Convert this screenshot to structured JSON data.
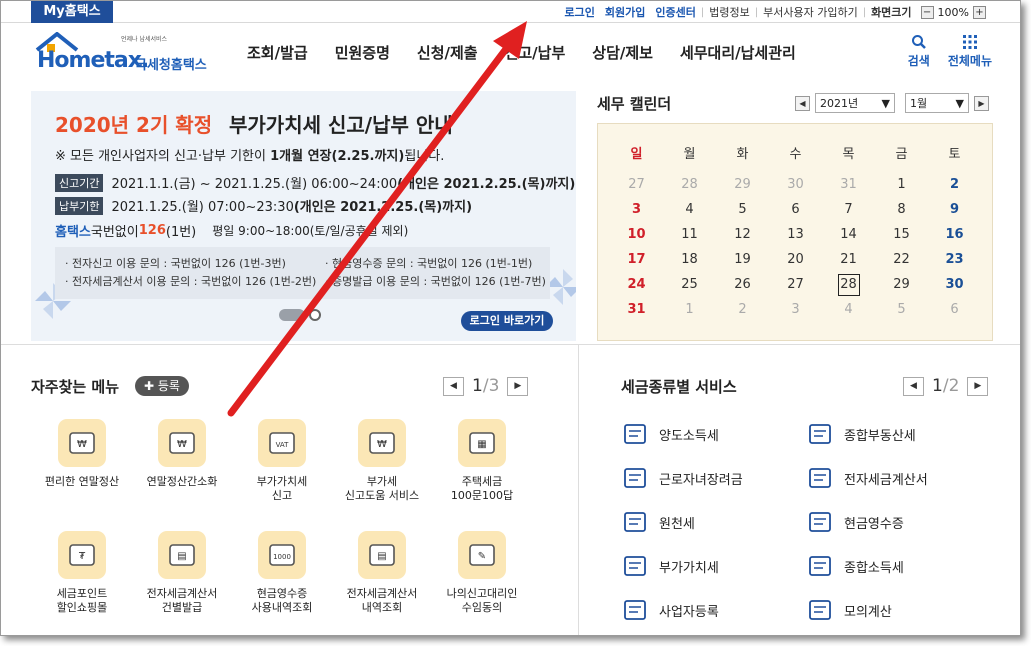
{
  "topbar": {
    "my_hometax": "My홈택스",
    "links": [
      "로그인",
      "회원가입",
      "인증센터",
      "법령정보",
      "부서사용자 가입하기",
      "화면크기"
    ],
    "zoom": "100%",
    "zoom_minus": "−",
    "zoom_plus": "+"
  },
  "logo": {
    "word": "Hometax.",
    "sub": "언제나 납세서비스",
    "kr": "국세청홈택스"
  },
  "menu": [
    "조회/발급",
    "민원증명",
    "신청/제출",
    "신고/납부",
    "상담/제보",
    "세무대리/납세관리"
  ],
  "nav_icons": {
    "search": "검색",
    "all_menu": "전체메뉴"
  },
  "banner": {
    "title_highlight": "2020년 2기 확정",
    "title_rest": "부가가치세 신고/납부 안내",
    "note_prefix": "※ 모든 개인사업자의 신고·납부 기한이 ",
    "note_bold": "1개월 연장(2.25.까지)",
    "note_suffix": "됩니다.",
    "row1_tag": "신고기간",
    "row1_text": "2021.1.1.(금) ~ 2021.1.25.(월) 06:00~24:00 ",
    "row1_bold": "(개인은 2021.2.25.(목)까지)",
    "row2_tag": "납부기한",
    "row2_text": "2021.1.25.(월) 07:00~23:30 ",
    "row2_bold": "(개인은 2021.2.25.(목)까지)",
    "row3_hometax": "홈택스",
    "row3_text": " 국번없이 ",
    "row3_num": "126",
    "row3_after": "(1번)",
    "row3_hours": "평일 9:00~18:00(토/일/공휴일 제외)",
    "info": [
      "· 전자신고 이용 문의 : 국번없이 126 (1번-3번)",
      "· 전자세금계산서 이용 문의 : 국번없이 126 (1번-2번)",
      "· 현금영수증 문의 : 국번없이 126 (1번-1번)",
      "· 증명발급 이용 문의 : 국번없이 126 (1번-7번)"
    ],
    "login_button": "로그인 바로가기"
  },
  "calendar": {
    "title": "세무 캘린더",
    "year": "2021년",
    "month": "1월",
    "weekdays": [
      "일",
      "월",
      "화",
      "수",
      "목",
      "금",
      "토"
    ],
    "weeks": [
      [
        "27",
        "28",
        "29",
        "30",
        "31",
        "1",
        "2"
      ],
      [
        "3",
        "4",
        "5",
        "6",
        "7",
        "8",
        "9"
      ],
      [
        "10",
        "11",
        "12",
        "13",
        "14",
        "15",
        "16"
      ],
      [
        "17",
        "18",
        "19",
        "20",
        "21",
        "22",
        "23"
      ],
      [
        "24",
        "25",
        "26",
        "27",
        "28",
        "29",
        "30"
      ],
      [
        "31",
        "1",
        "2",
        "3",
        "4",
        "5",
        "6"
      ]
    ],
    "today": "28"
  },
  "favorites": {
    "title": "자주찾는 메뉴",
    "register": "등록",
    "page_current": "1",
    "page_total": "3",
    "items": [
      "편리한 연말정산",
      "연말정산간소화",
      "부가가치세\n신고",
      "부가세\n신고도움 서비스",
      "주택세금\n100문100답",
      "세금포인트\n할인쇼핑몰",
      "전자세금계산서\n건별발급",
      "현금영수증\n사용내역조회",
      "전자세금계산서\n내역조회",
      "나의신고대리인\n수임동의"
    ]
  },
  "tax_services": {
    "title": "세금종류별 서비스",
    "page_current": "1",
    "page_total": "2",
    "items": [
      "양도소득세",
      "종합부동산세",
      "근로자녀장려금",
      "전자세금계산서",
      "원천세",
      "현금영수증",
      "부가가치세",
      "종합소득세",
      "사업자등록",
      "모의계산"
    ]
  },
  "colors": {
    "brand_blue": "#1f4e9a",
    "accent_orange": "#e8502b",
    "annotation_red": "#e02020"
  }
}
